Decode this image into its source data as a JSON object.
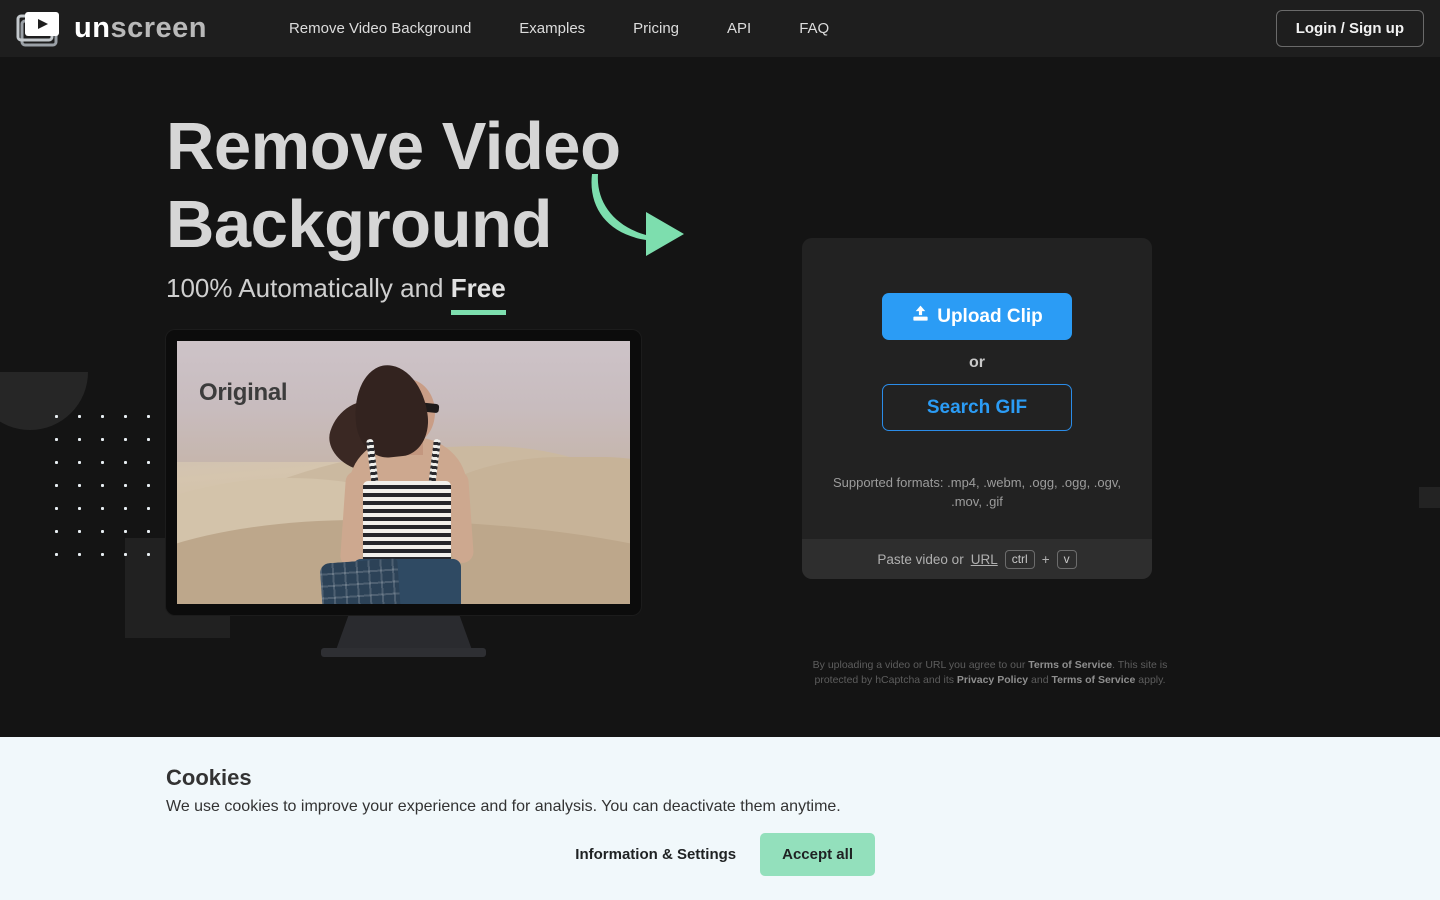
{
  "header": {
    "logo": {
      "icon": "video-stack-play-icon",
      "word_first": "un",
      "word_second": "screen"
    },
    "nav": [
      {
        "label": "Remove Video Background"
      },
      {
        "label": "Examples"
      },
      {
        "label": "Pricing"
      },
      {
        "label": "API"
      },
      {
        "label": "FAQ"
      }
    ],
    "login_label": "Login / Sign up"
  },
  "hero": {
    "title_line1": "Remove Video",
    "title_line2": "Background",
    "subtitle_prefix": "100% Automatically and ",
    "subtitle_emphasis": "Free",
    "arrow_icon": "curved-arrow-down-right-icon",
    "arrow_color": "#7ddeae"
  },
  "preview": {
    "label": "Original",
    "device": "desktop-monitor"
  },
  "upload": {
    "upload_icon": "upload-icon",
    "upload_label": "Upload Clip",
    "or_label": "or",
    "search_gif_label": "Search GIF",
    "formats_note": "Supported formats: .mp4, .webm, .ogg, .ogg, .ogv, .mov, .gif",
    "paste_prefix": "Paste video or ",
    "paste_link": "URL",
    "key_ctrl": "ctrl",
    "key_plus": "+",
    "key_v": "v",
    "accent_blue": "#2b9cf5"
  },
  "legal": {
    "part1": "By uploading a video or URL you agree to our ",
    "terms1": "Terms of Service",
    "part2": ". This site is protected by hCaptcha and its ",
    "privacy": "Privacy Policy",
    "part3": " and ",
    "terms2": "Terms of Service",
    "part4": " apply."
  },
  "cookies": {
    "title": "Cookies",
    "text": "We use cookies to improve your experience and for analysis. You can deactivate them anytime.",
    "info_label": "Information & Settings",
    "accept_label": "Accept all",
    "accept_color": "#93e0bc",
    "background": "#f1f8fb"
  }
}
